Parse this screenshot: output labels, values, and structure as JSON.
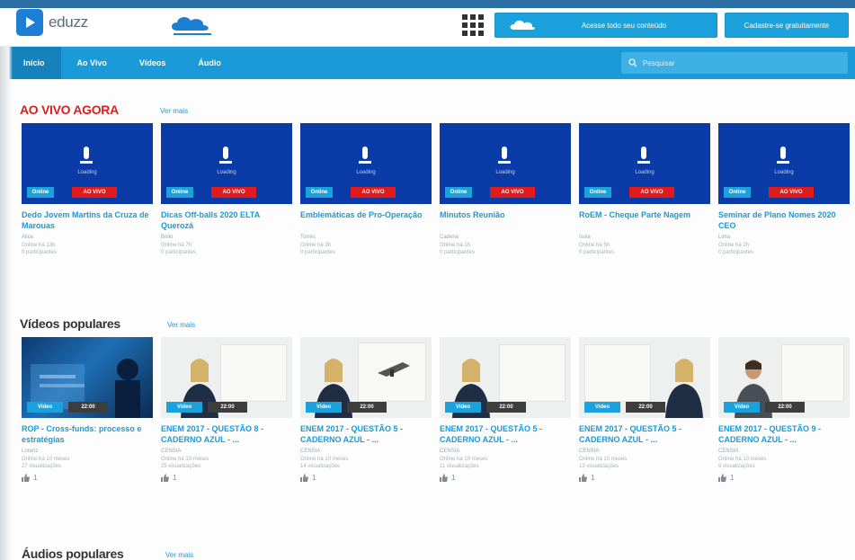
{
  "header": {
    "logo_text": "eduzz",
    "cloud_button": "Acesse todo seu conteúdo",
    "create_button": "Cadastre-se gratuitamente",
    "colors": {
      "primary": "#1a9ad8",
      "live_bg": "#0a3ba7",
      "live_tag": "#e11b1b"
    }
  },
  "nav": {
    "items": [
      {
        "label": "Início"
      },
      {
        "label": "Ao Vivo"
      },
      {
        "label": "Vídeos"
      },
      {
        "label": "Áudio"
      }
    ],
    "search_placeholder": "Pesquisar"
  },
  "live": {
    "title": "AO VIVO AGORA",
    "see_all": "Ver mais",
    "caption": "Loading",
    "badge_left": "Online",
    "badge_right": "AO VIVO",
    "cards": [
      {
        "title": "Dedo Jovem Martins da Cruza de Marouas",
        "author": "Alice",
        "meta1": "Online há 13h",
        "meta2": "0 participantes"
      },
      {
        "title": "Dicas Off-balls 2020 ELTA Querozá",
        "author": "Bolio",
        "meta1": "Online há 7h",
        "meta2": "0 participantes"
      },
      {
        "title": "Emblemáticas de Pro-Operação",
        "author": "Torres",
        "meta1": "Online há 3h",
        "meta2": "0 participantes"
      },
      {
        "title": "Minutos Reunião",
        "author": "Cadena",
        "meta1": "Online há 1h",
        "meta2": "0 participantes"
      },
      {
        "title": "RoEM - Cheque Parte Nagem",
        "author": "Isola",
        "meta1": "Online há 5h",
        "meta2": "0 participantes"
      },
      {
        "title": "Seminar de Plano Nomes 2020 CEO",
        "author": "Lima",
        "meta1": "Online há 2h",
        "meta2": "0 participantes"
      }
    ]
  },
  "videos": {
    "title": "Vídeos populares",
    "see_all": "Ver mais",
    "badge_left": "Vídeo",
    "badge_right": "22:00",
    "cards": [
      {
        "title": "ROP - Cross-funds: processo e estratégias",
        "author": "Lorenz",
        "meta1": "Online há 10 meses",
        "meta2": "27 visualizações",
        "likes": "1"
      },
      {
        "title": "ENEM 2017 - QUESTÃO 8 - CADERNO AZUL - ...",
        "author": "CENSIA",
        "meta1": "Online há 10 meses",
        "meta2": "25 visualizações",
        "likes": "1"
      },
      {
        "title": "ENEM 2017 - QUESTÃO 5 - CADERNO AZUL - ...",
        "author": "CENSIA",
        "meta1": "Online há 10 meses",
        "meta2": "14 visualizações",
        "likes": "1"
      },
      {
        "title": "ENEM 2017 - QUESTÃO 5 - CADERNO AZUL - ...",
        "author": "CENSIA",
        "meta1": "Online há 10 meses",
        "meta2": "11 visualizações",
        "likes": "1"
      },
      {
        "title": "ENEM 2017 - QUESTÃO 5 - CADERNO AZUL - ...",
        "author": "CENSIA",
        "meta1": "Online há 10 meses",
        "meta2": "13 visualizações",
        "likes": "1"
      },
      {
        "title": "ENEM 2017 - QUESTÃO 9 - CADERNO AZUL - ...",
        "author": "CENSIA",
        "meta1": "Online há 10 meses",
        "meta2": "9 visualizações",
        "likes": "1"
      }
    ]
  },
  "audios": {
    "title": "Áudios populares",
    "see_all": "Ver mais"
  }
}
